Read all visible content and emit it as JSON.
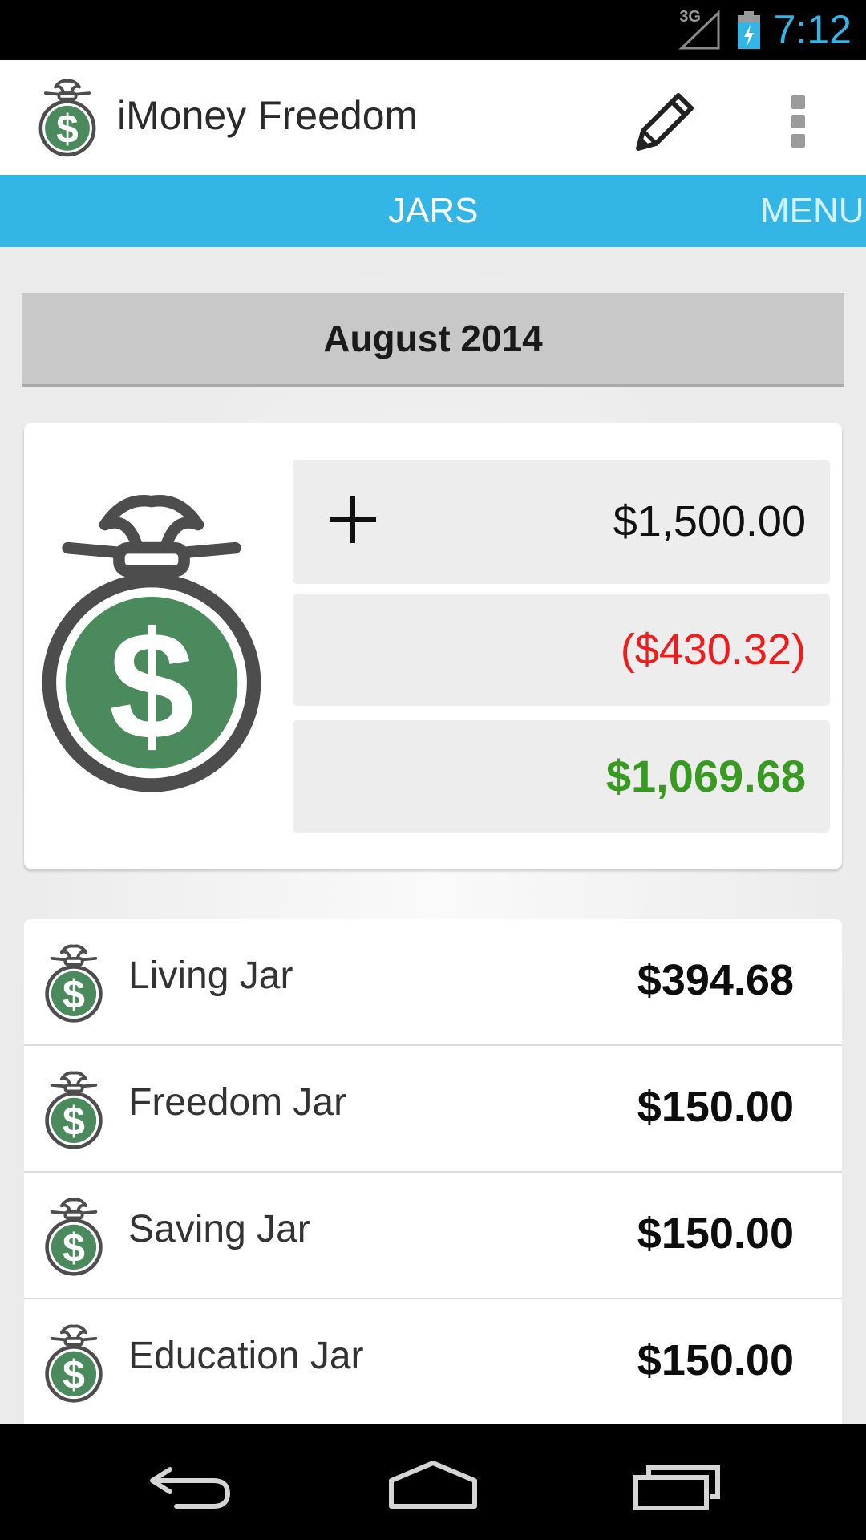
{
  "status_bar": {
    "network": "3G",
    "time": "7:12",
    "time_color": "#33b5e5"
  },
  "action_bar": {
    "app_icon": "money-bag-icon",
    "title": "iMoney Freedom",
    "edit_icon": "pencil-icon",
    "overflow_icon": "overflow-menu-icon"
  },
  "tabs": [
    {
      "label": "JARS",
      "selected": true
    },
    {
      "label": "MENU",
      "selected": false
    }
  ],
  "colors": {
    "accent": "#33b5e5",
    "expense": "#ee1c1c",
    "balance": "#399a22",
    "bag_green": "#4a8a5c",
    "bag_outline": "#4d4d4d"
  },
  "month": "August 2014",
  "summary": {
    "add_icon": "plus-icon",
    "income": "$1,500.00",
    "expense": "($430.32)",
    "balance": "$1,069.68"
  },
  "jars": [
    {
      "name": "Living Jar",
      "amount": "$394.68"
    },
    {
      "name": "Freedom Jar",
      "amount": "$150.00"
    },
    {
      "name": "Saving Jar",
      "amount": "$150.00"
    },
    {
      "name": "Education Jar",
      "amount": "$150.00"
    }
  ],
  "nav": {
    "back_icon": "back-icon",
    "home_icon": "home-icon",
    "recents_icon": "recents-icon"
  }
}
